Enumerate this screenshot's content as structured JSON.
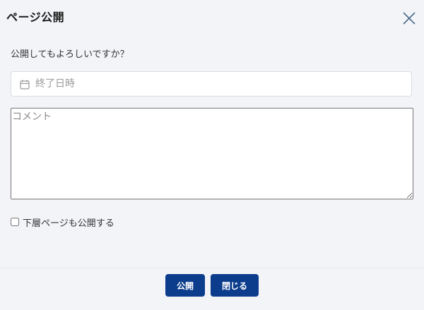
{
  "dialog": {
    "title": "ページ公開",
    "close_icon": "close-icon",
    "question": "公開してもよろしいですか？",
    "end_date": {
      "icon": "calendar-icon",
      "placeholder": "終了日時",
      "value": ""
    },
    "comment": {
      "placeholder": "コメント",
      "value": ""
    },
    "include_subpages": {
      "label": "下層ページも公開する",
      "checked": false
    },
    "buttons": {
      "publish_label": "公開",
      "close_label": "閉じる"
    }
  },
  "colors": {
    "background": "#f3f4f8",
    "primary_button": "#0b3d8c",
    "button_text": "#ffffff",
    "close_icon": "#4a6b8a"
  }
}
